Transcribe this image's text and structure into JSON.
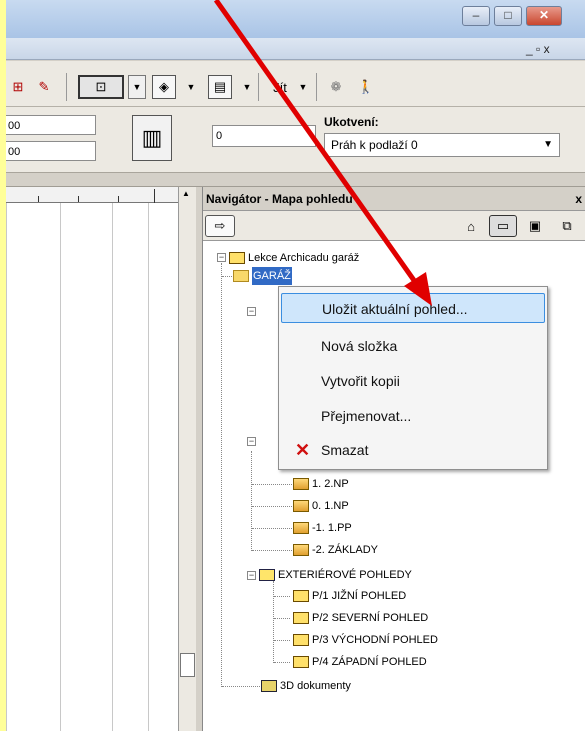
{
  "window": {
    "minimize_glyph": "–",
    "maximize_glyph": "□",
    "close_glyph": "✕",
    "mdi_controls": "_ ▫ x"
  },
  "toolbar": {
    "goto_label": "Jít"
  },
  "infobox": {
    "field1": "00",
    "field2": "00",
    "field3": "0",
    "anchor_label": "Ukotvení:",
    "anchor_value": "Práh k podlaží 0"
  },
  "navigator": {
    "title": "Navigátor - Mapa pohledu",
    "close_glyph": "x",
    "tree": {
      "root": "Lekce Archicadu garáž",
      "folder_selected": "GARÁŽ",
      "floors": [
        "1. 2.NP",
        "0. 1.NP",
        "-1. 1.PP",
        "-2. ZÁKLADY"
      ],
      "elevations_folder": "EXTERIÉROVÉ POHLEDY",
      "elevations": [
        "P/1 JIŽNÍ POHLED",
        "P/2 SEVERNÍ POHLED",
        "P/3 VÝCHODNÍ POHLED",
        "P/4 ZÁPADNÍ POHLED"
      ],
      "documents_3d": "3D dokumenty"
    }
  },
  "context_menu": {
    "items": [
      {
        "label": "Uložit aktuální pohled..."
      },
      {
        "label": "Nová složka"
      },
      {
        "label": "Vytvořit kopii"
      },
      {
        "label": "Přejmenovat..."
      },
      {
        "label": "Smazat"
      }
    ]
  },
  "colors": {
    "background": "#ffff99",
    "arrow": "#e00000",
    "menu_highlight": "#cfe6fb"
  }
}
